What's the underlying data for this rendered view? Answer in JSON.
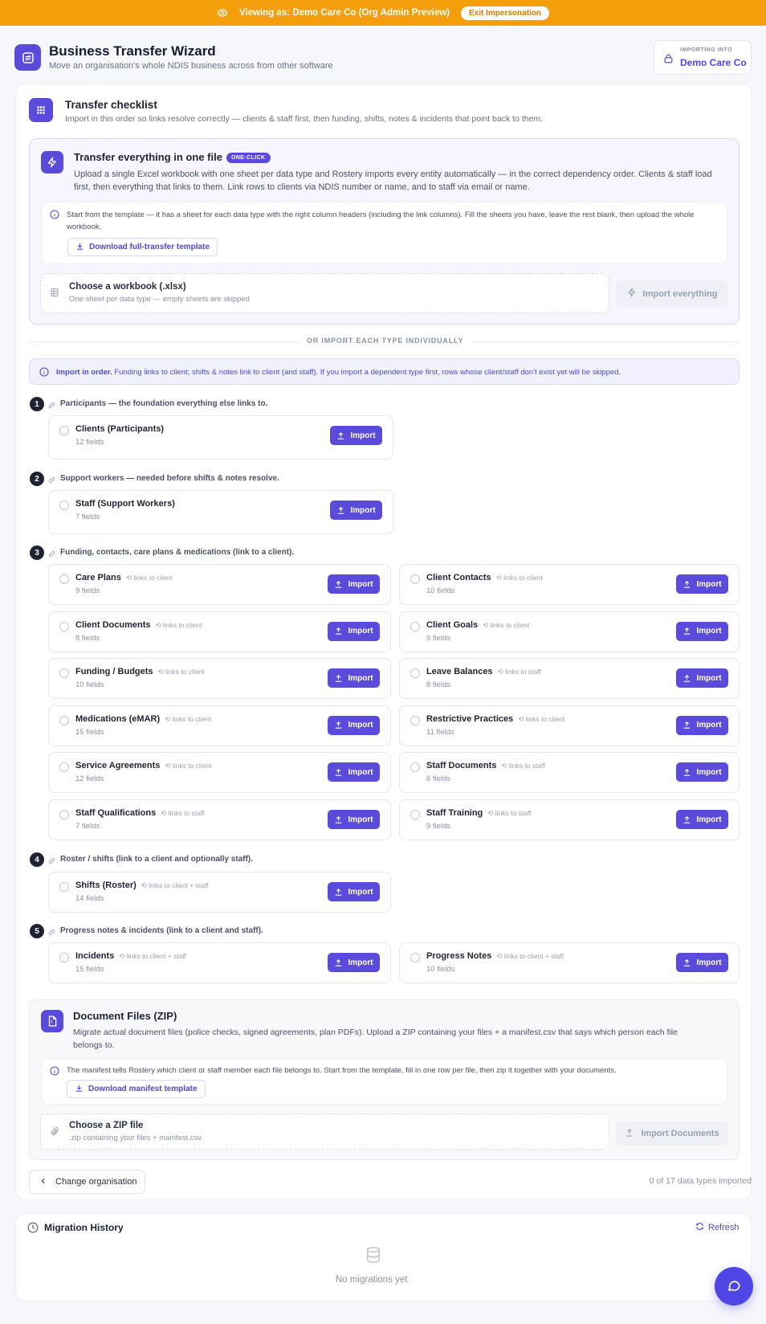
{
  "banner": {
    "text": "Viewing as: Demo Care Co (Org Admin Preview)",
    "exit_label": "Exit Impersonation"
  },
  "header": {
    "title": "Business Transfer Wizard",
    "subtitle": "Move an organisation's whole NDIS business across from other software",
    "importing_label": "IMPORTING INTO",
    "importing_org": "Demo Care Co"
  },
  "checklist": {
    "title": "Transfer checklist",
    "subtitle": "Import in this order so links resolve correctly — clients & staff first, then funding, shifts, notes & incidents that point back to them."
  },
  "one_file": {
    "title": "Transfer everything in one file",
    "badge": "ONE-CLICK",
    "description": "Upload a single Excel workbook with one sheet per data type and Rostery imports every entity automatically — in the correct dependency order. Clients & staff load first, then everything that links to them. Link rows to clients via NDIS number or name, and to staff via email or name.",
    "template_note": "Start from the template — it has a sheet for each data type with the right column headers (including the link columns). Fill the sheets you have, leave the rest blank, then upload the whole workbook.",
    "download_label": "Download full-transfer template",
    "dropzone_title": "Choose a workbook (.xlsx)",
    "dropzone_sub": "One sheet per data type — empty sheets are skipped",
    "import_all_label": "Import everything"
  },
  "divider_label": "OR IMPORT EACH TYPE INDIVIDUALLY",
  "notice": {
    "bold": "Import in order.",
    "text": " Funding links to client; shifts & notes link to client (and staff). If you import a dependent type first, rows whose client/staff don't exist yet will be skipped."
  },
  "import_label": "Import",
  "steps": [
    {
      "num": "1",
      "label": "Participants — the foundation everything else links to.",
      "items": [
        {
          "name": "Clients (Participants)",
          "link": "",
          "fields": "12 fields"
        }
      ]
    },
    {
      "num": "2",
      "label": "Support workers — needed before shifts & notes resolve.",
      "items": [
        {
          "name": "Staff (Support Workers)",
          "link": "",
          "fields": "7 fields"
        }
      ]
    },
    {
      "num": "3",
      "label": "Funding, contacts, care plans & medications (link to a client).",
      "items": [
        {
          "name": "Care Plans",
          "link": "links to client",
          "fields": "9 fields"
        },
        {
          "name": "Client Contacts",
          "link": "links to client",
          "fields": "10 fields"
        },
        {
          "name": "Client Documents",
          "link": "links to client",
          "fields": "8 fields"
        },
        {
          "name": "Client Goals",
          "link": "links to client",
          "fields": "9 fields"
        },
        {
          "name": "Funding / Budgets",
          "link": "links to client",
          "fields": "10 fields"
        },
        {
          "name": "Leave Balances",
          "link": "links to staff",
          "fields": "8 fields"
        },
        {
          "name": "Medications (eMAR)",
          "link": "links to client",
          "fields": "15 fields"
        },
        {
          "name": "Restrictive Practices",
          "link": "links to client",
          "fields": "11 fields"
        },
        {
          "name": "Service Agreements",
          "link": "links to client",
          "fields": "12 fields"
        },
        {
          "name": "Staff Documents",
          "link": "links to staff",
          "fields": "6 fields"
        },
        {
          "name": "Staff Qualifications",
          "link": "links to staff",
          "fields": "7 fields"
        },
        {
          "name": "Staff Training",
          "link": "links to staff",
          "fields": "9 fields"
        }
      ]
    },
    {
      "num": "4",
      "label": "Roster / shifts (link to a client and optionally staff).",
      "items": [
        {
          "name": "Shifts (Roster)",
          "link": "links to client + staff",
          "fields": "14 fields"
        }
      ]
    },
    {
      "num": "5",
      "label": "Progress notes & incidents (link to a client and staff).",
      "items": [
        {
          "name": "Incidents",
          "link": "links to client + staff",
          "fields": "15 fields"
        },
        {
          "name": "Progress Notes",
          "link": "links to client + staff",
          "fields": "10 fields"
        }
      ]
    }
  ],
  "zip": {
    "title": "Document Files (ZIP)",
    "description": "Migrate actual document files (police checks, signed agreements, plan PDFs). Upload a ZIP containing your files + a manifest.csv  that says which person each file belongs to.",
    "note": "The manifest tells Rostery which client or staff member each file belongs to. Start from the template, fill in one row per file, then zip it together with your documents.",
    "download_label": "Download manifest template",
    "dropzone_title": "Choose a ZIP file",
    "dropzone_sub": ".zip containing your files + manifest.csv",
    "import_label": "Import Documents"
  },
  "footer": {
    "change_org_label": "Change organisation",
    "progress": "0 of 17 data types imported"
  },
  "history": {
    "title": "Migration History",
    "refresh_label": "Refresh",
    "empty": "No migrations yet"
  },
  "colors": {
    "accent": "#5b4bdb",
    "banner": "#f59e0b",
    "link": "#4f46e5"
  }
}
